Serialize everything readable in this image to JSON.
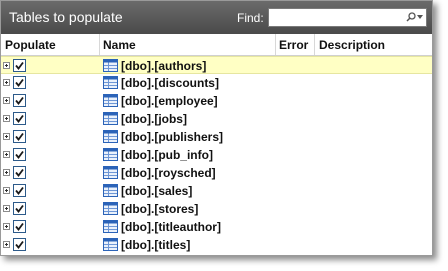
{
  "header": {
    "title": "Tables to populate",
    "find_label": "Find:",
    "find_value": ""
  },
  "columns": {
    "populate": "Populate",
    "name": "Name",
    "error": "Error",
    "description": "Description"
  },
  "rows": [
    {
      "name": "[dbo].[authors]",
      "checked": true,
      "selected": true
    },
    {
      "name": "[dbo].[discounts]",
      "checked": true
    },
    {
      "name": "[dbo].[employee]",
      "checked": true
    },
    {
      "name": "[dbo].[jobs]",
      "checked": true
    },
    {
      "name": "[dbo].[publishers]",
      "checked": true
    },
    {
      "name": "[dbo].[pub_info]",
      "checked": true
    },
    {
      "name": "[dbo].[roysched]",
      "checked": true
    },
    {
      "name": "[dbo].[sales]",
      "checked": true
    },
    {
      "name": "[dbo].[stores]",
      "checked": true
    },
    {
      "name": "[dbo].[titleauthor]",
      "checked": true
    },
    {
      "name": "[dbo].[titles]",
      "checked": true
    }
  ],
  "colors": {
    "header_bg": "#5a5a5a",
    "selected_row_bg": "#ffffc4",
    "checkbox_border": "#2c5a8a",
    "table_icon": "#2b63b8"
  },
  "icons": {
    "find": "search-dropdown-icon",
    "table": "table-icon",
    "expander": "plus-box-icon",
    "checkbox": "checkmark-icon"
  }
}
